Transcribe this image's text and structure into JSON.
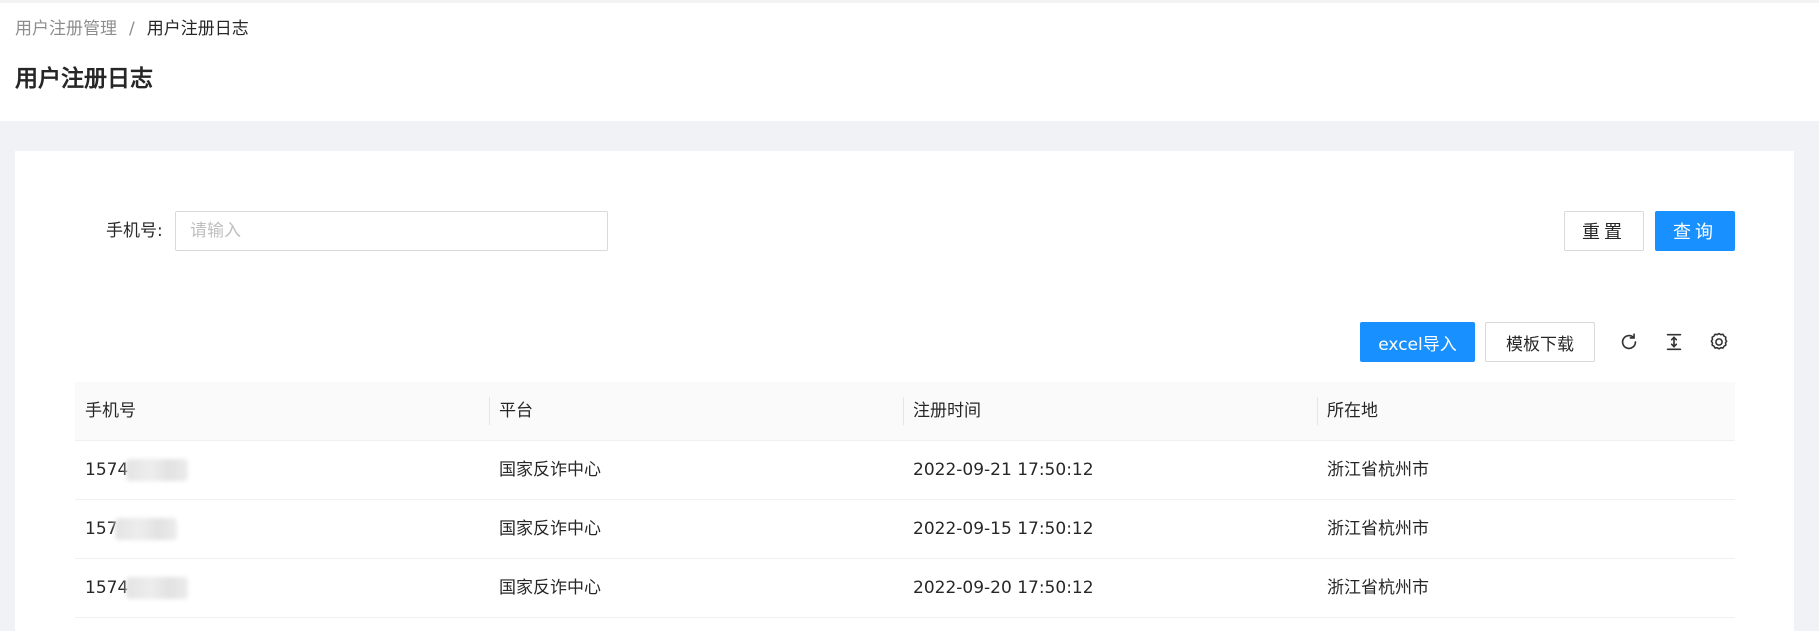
{
  "breadcrumb": {
    "items": [
      "用户注册管理",
      "用户注册日志"
    ],
    "separator": "/"
  },
  "page": {
    "title": "用户注册日志"
  },
  "search": {
    "label": "手机号:",
    "placeholder": "请输入",
    "value": "",
    "reset_label": "重置",
    "query_label": "查询"
  },
  "toolbar": {
    "import_label": "excel导入",
    "template_label": "模板下载",
    "icons": [
      "reload-icon",
      "column-height-icon",
      "setting-icon"
    ]
  },
  "table": {
    "columns": [
      "手机号",
      "平台",
      "注册时间",
      "所在地"
    ],
    "rows": [
      {
        "phone": "1574",
        "platform": "国家反诈中心",
        "time": "2022-09-21 17:50:12",
        "location": "浙江省杭州市"
      },
      {
        "phone": "157",
        "platform": "国家反诈中心",
        "time": "2022-09-15 17:50:12",
        "location": "浙江省杭州市"
      },
      {
        "phone": "1574",
        "platform": "国家反诈中心",
        "time": "2022-09-20 17:50:12",
        "location": "浙江省杭州市"
      }
    ]
  },
  "colors": {
    "primary": "#1890ff",
    "background": "#f0f2f5",
    "header_bg": "#fafafa"
  }
}
